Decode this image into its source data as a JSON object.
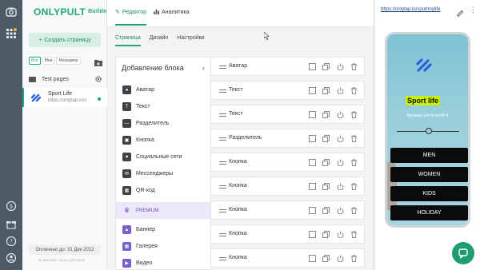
{
  "brand": {
    "name": "ONLYPULT",
    "suffix": "Builder"
  },
  "topbar": {
    "tabs": [
      {
        "label": "Редактор",
        "icon": "pencil-icon"
      },
      {
        "label": "Аналитика",
        "icon": "bar-chart-icon"
      }
    ]
  },
  "sidebar": {
    "new_page_label": "Создать страницу",
    "filters": [
      "Все",
      "Мои",
      "Менеджер"
    ],
    "folder_label": "Test pages",
    "project": {
      "name": "Sport Life",
      "url": "https://onlytap.io/s"
    },
    "paid_until": "Оплачено до: 31 Дек 2022",
    "timestamp": "02 Фев 2022 - 11:14  |  UTC+3:00"
  },
  "subtabs": [
    "Страница",
    "Дизайн",
    "Настройки"
  ],
  "add_block": {
    "title": "Добавление блока",
    "items": [
      {
        "label": "Аватар",
        "icon": "avatar-icon"
      },
      {
        "label": "Текст",
        "icon": "text-icon"
      },
      {
        "label": "Разделитель",
        "icon": "divider-icon"
      },
      {
        "label": "Кнопка",
        "icon": "button-icon"
      },
      {
        "label": "Социальные сети",
        "icon": "social-icon"
      },
      {
        "label": "Мессенджеры",
        "icon": "chat-icon"
      },
      {
        "label": "QR-код",
        "icon": "qr-icon"
      },
      {
        "label": "PREMIUM",
        "icon": "crown-icon"
      },
      {
        "label": "Баннер",
        "icon": "image-icon"
      },
      {
        "label": "Галерея",
        "icon": "gallery-icon"
      },
      {
        "label": "Видео",
        "icon": "video-icon"
      }
    ]
  },
  "blocks": [
    "Аватар",
    "Текст",
    "Текст",
    "Разделитель",
    "Кнопка",
    "Кнопка",
    "Кнопка",
    "Кнопка",
    "Кнопка"
  ],
  "preview": {
    "url": "https://onlytap.io/sportmylife",
    "title": "Sport life",
    "subtitle": "Because you're worth it",
    "buttons": [
      "MEN",
      "WOMEN",
      "KIDS",
      "HOLIDAY"
    ]
  },
  "colors": {
    "accent": "#21a67a",
    "rail": "#4c5a66",
    "premium": "#7b5fcc"
  }
}
